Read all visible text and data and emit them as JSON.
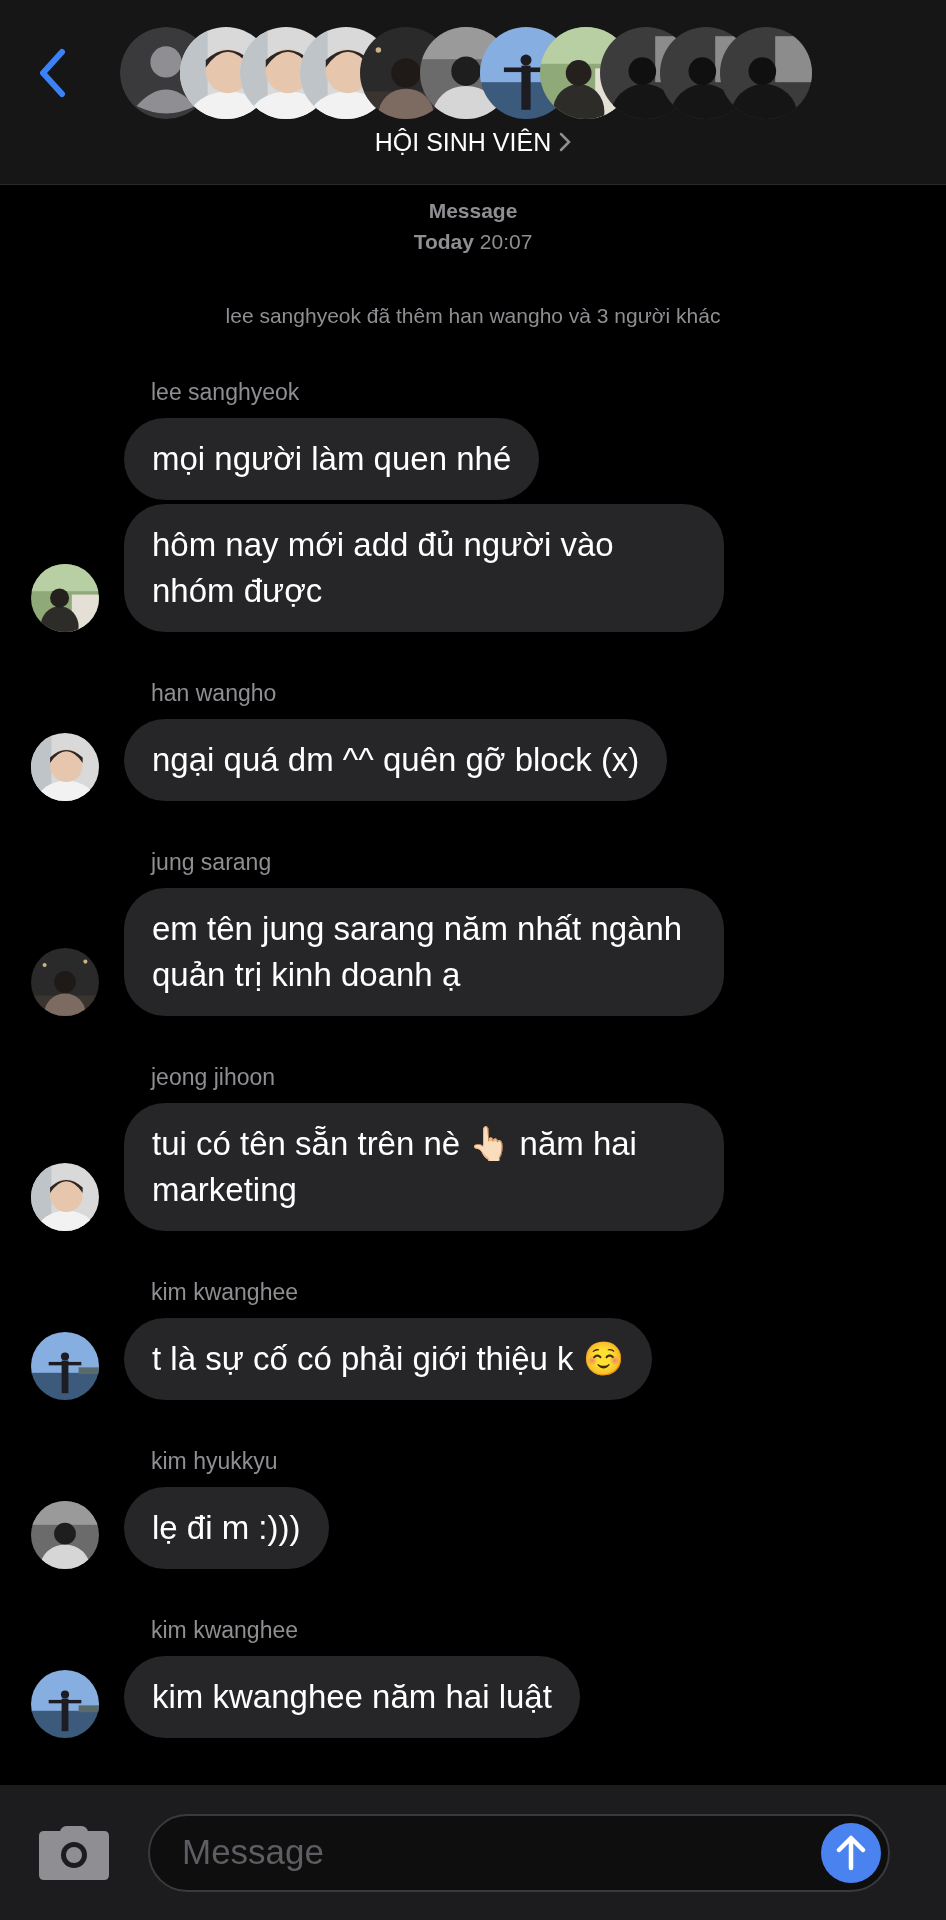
{
  "header": {
    "avatars": [
      {
        "kind": "placeholder"
      },
      {
        "kind": "picture"
      },
      {
        "kind": "picture"
      },
      {
        "kind": "picture"
      },
      {
        "kind": "picture"
      },
      {
        "kind": "picture"
      },
      {
        "kind": "picture"
      },
      {
        "kind": "picture"
      },
      {
        "kind": "picture"
      },
      {
        "kind": "picture"
      },
      {
        "kind": "picture"
      }
    ],
    "group_name": "HỘI SINH VIÊN"
  },
  "timestamp": {
    "service": "Message",
    "day": "Today",
    "time": "20:07"
  },
  "system_notice": "lee sanghyeok đã thêm han wangho và 3 người khác",
  "groups": [
    {
      "sender": "lee sanghyeok",
      "messages": [
        "mọi người làm quen nhé",
        "hôm nay mới add đủ người vào nhóm được"
      ]
    },
    {
      "sender": "han wangho",
      "messages": [
        "ngại quá dm ^^ quên gỡ block (x)"
      ]
    },
    {
      "sender": "jung sarang",
      "messages": [
        "em tên jung sarang năm nhất ngành quản trị kinh doanh ạ"
      ]
    },
    {
      "sender": "jeong jihoon",
      "messages": [
        "tui có tên sẵn trên nè 👆🏻 năm hai marketing"
      ]
    },
    {
      "sender": "kim kwanghee",
      "messages": [
        "t là sự cố có phải giới thiệu k ☺️"
      ]
    },
    {
      "sender": "kim hyukkyu",
      "messages": [
        "lẹ đi m :)))"
      ]
    },
    {
      "sender": "kim kwanghee",
      "messages": [
        "kim kwanghee năm hai luật"
      ]
    }
  ],
  "composer": {
    "placeholder": "Message"
  }
}
